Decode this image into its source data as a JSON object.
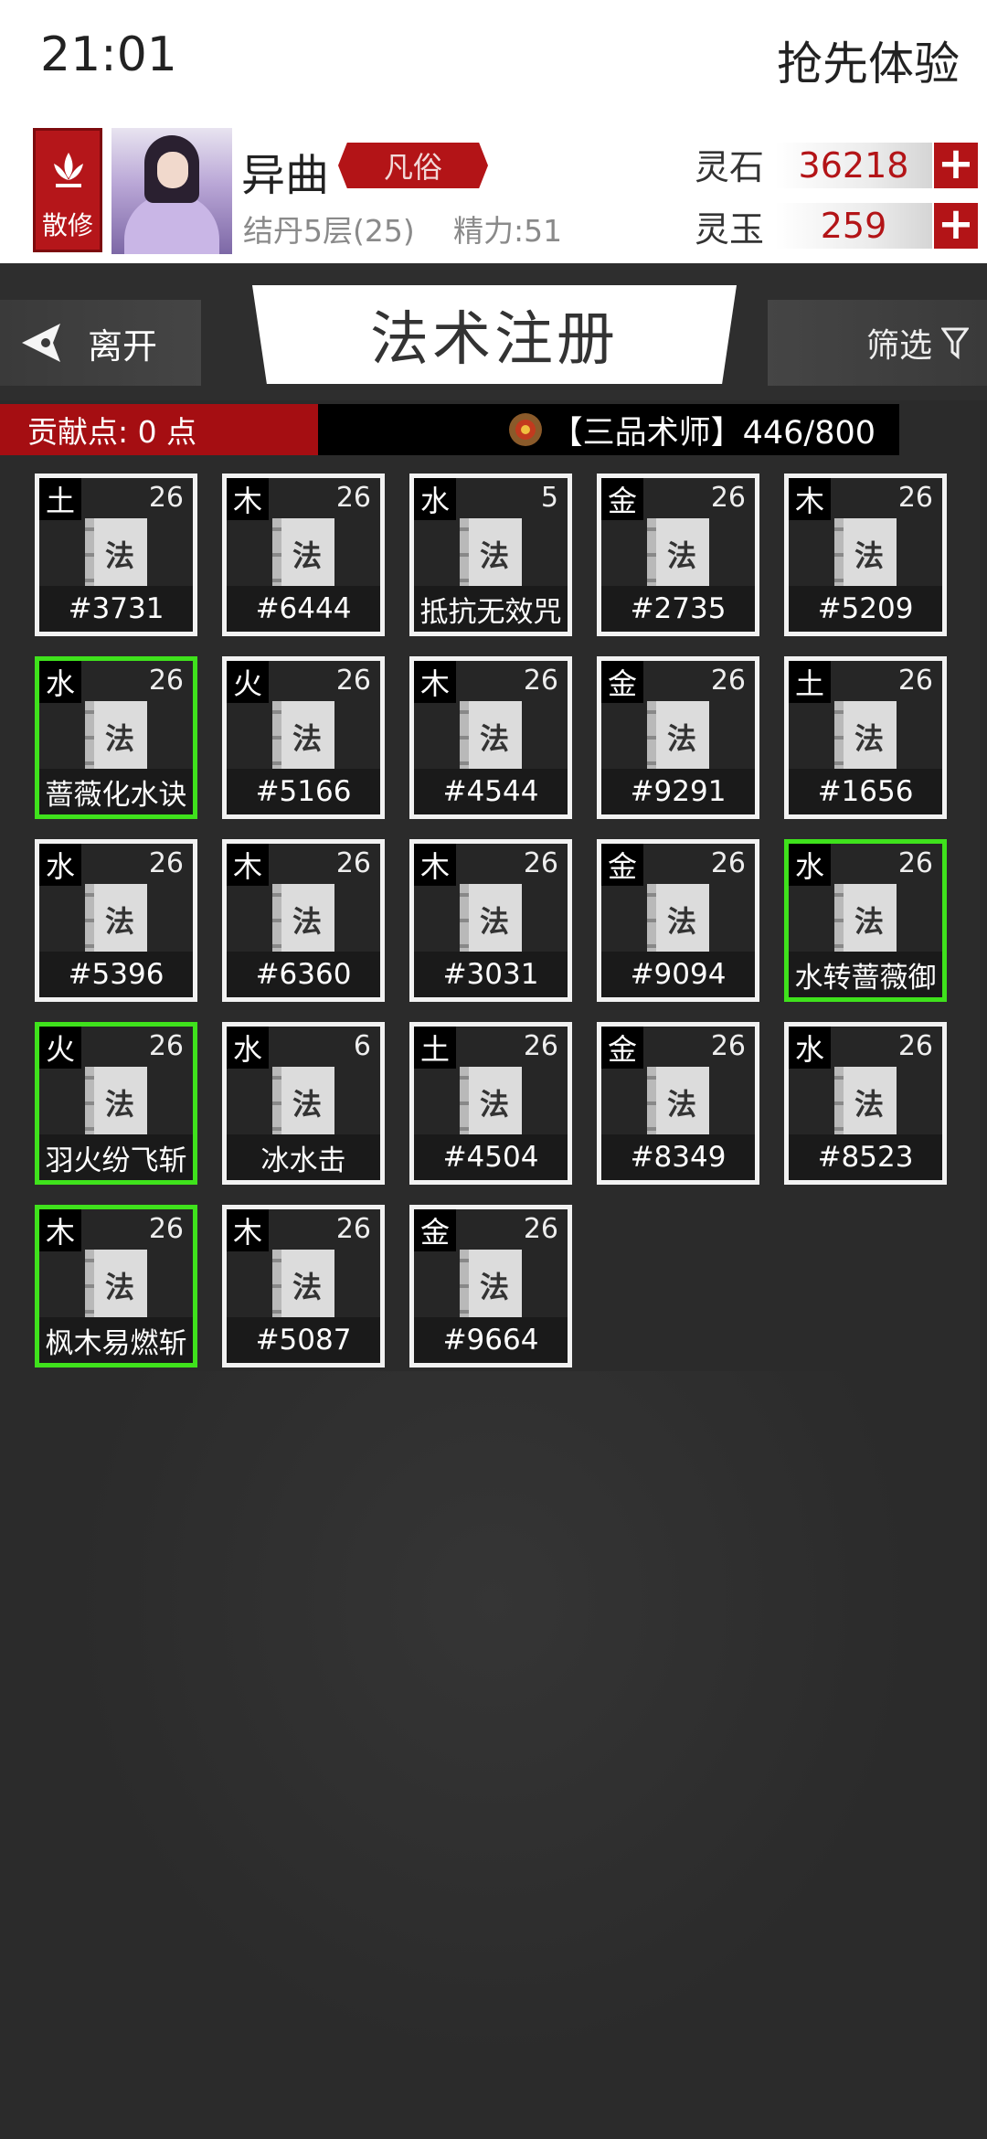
{
  "status_bar": {
    "time": "21:01",
    "right_text": "抢先体验"
  },
  "profile": {
    "rank_label": "散修",
    "name": "异曲",
    "realm_tag": "凡俗",
    "level": "结丹5层(25)",
    "energy": "精力:51",
    "currencies": [
      {
        "label": "灵石",
        "value": "36218",
        "plus": "+"
      },
      {
        "label": "灵玉",
        "value": "259",
        "plus": "+"
      }
    ]
  },
  "titlebar": {
    "leave_label": "离开",
    "title": "法术注册",
    "filter_label": "筛选"
  },
  "contribution": {
    "text": "贡献点: 0 点"
  },
  "master": {
    "text": "【三品术师】446/800"
  },
  "book_char": "法",
  "cards": [
    {
      "element": "土",
      "level": "26",
      "name": "#3731",
      "highlight": false
    },
    {
      "element": "木",
      "level": "26",
      "name": "#6444",
      "highlight": false
    },
    {
      "element": "水",
      "level": "5",
      "name": "抵抗无效咒",
      "highlight": false
    },
    {
      "element": "金",
      "level": "26",
      "name": "#2735",
      "highlight": false
    },
    {
      "element": "木",
      "level": "26",
      "name": "#5209",
      "highlight": false
    },
    {
      "element": "水",
      "level": "26",
      "name": "蔷薇化水诀",
      "highlight": true
    },
    {
      "element": "火",
      "level": "26",
      "name": "#5166",
      "highlight": false
    },
    {
      "element": "木",
      "level": "26",
      "name": "#4544",
      "highlight": false
    },
    {
      "element": "金",
      "level": "26",
      "name": "#9291",
      "highlight": false
    },
    {
      "element": "土",
      "level": "26",
      "name": "#1656",
      "highlight": false
    },
    {
      "element": "水",
      "level": "26",
      "name": "#5396",
      "highlight": false
    },
    {
      "element": "木",
      "level": "26",
      "name": "#6360",
      "highlight": false
    },
    {
      "element": "木",
      "level": "26",
      "name": "#3031",
      "highlight": false
    },
    {
      "element": "金",
      "level": "26",
      "name": "#9094",
      "highlight": false
    },
    {
      "element": "水",
      "level": "26",
      "name": "水转蔷薇御",
      "highlight": true
    },
    {
      "element": "火",
      "level": "26",
      "name": "羽火纷飞斩",
      "highlight": true
    },
    {
      "element": "水",
      "level": "6",
      "name": "冰水击",
      "highlight": false
    },
    {
      "element": "土",
      "level": "26",
      "name": "#4504",
      "highlight": false
    },
    {
      "element": "金",
      "level": "26",
      "name": "#8349",
      "highlight": false
    },
    {
      "element": "水",
      "level": "26",
      "name": "#8523",
      "highlight": false
    },
    {
      "element": "木",
      "level": "26",
      "name": "枫木易燃斩",
      "highlight": true
    },
    {
      "element": "木",
      "level": "26",
      "name": "#5087",
      "highlight": false
    },
    {
      "element": "金",
      "level": "26",
      "name": "#9664",
      "highlight": false
    }
  ],
  "colors": {
    "accent_red": "#b31417",
    "highlight_green": "#3fe21c",
    "background": "#2b2b2b"
  }
}
